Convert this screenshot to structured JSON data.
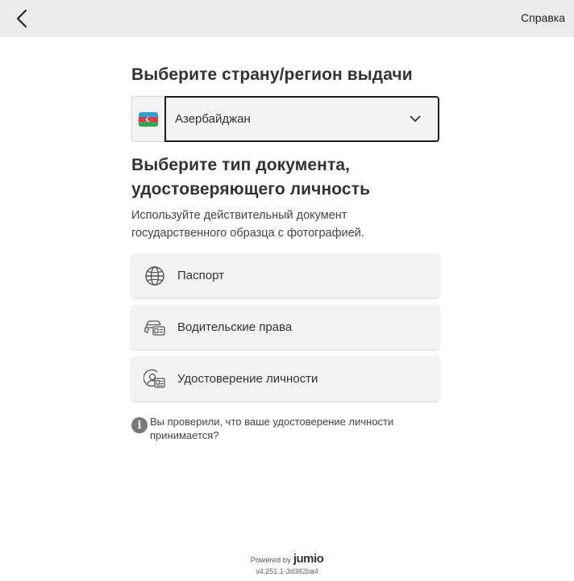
{
  "header": {
    "back_icon": "chevron-left-icon",
    "help_label": "Справка"
  },
  "country": {
    "title": "Выберите страну/регион выдачи",
    "selected": "Азербайджан",
    "flag_icon": "azerbaijan-flag-icon",
    "dropdown_icon": "chevron-down-icon"
  },
  "document": {
    "title_line1": "Выберите тип документа,",
    "title_line2": "удостоверяющего личность",
    "subtitle_line1": "Используйте действительный документ",
    "subtitle_line2": "государственного образца с фотографией.",
    "options": [
      {
        "label": "Паспорт",
        "icon": "globe-icon"
      },
      {
        "label": "Водительские права",
        "icon": "car-license-icon"
      },
      {
        "label": "Удостоверение личности",
        "icon": "id-card-icon"
      }
    ]
  },
  "info": {
    "icon": "info-icon",
    "line1": "Вы проверили, что ваше удостоверение личности",
    "line2": "принимается?"
  },
  "footer": {
    "powered_by": "Powered by",
    "brand": "jumio",
    "version": "v4.251.1-3d382ba4"
  }
}
